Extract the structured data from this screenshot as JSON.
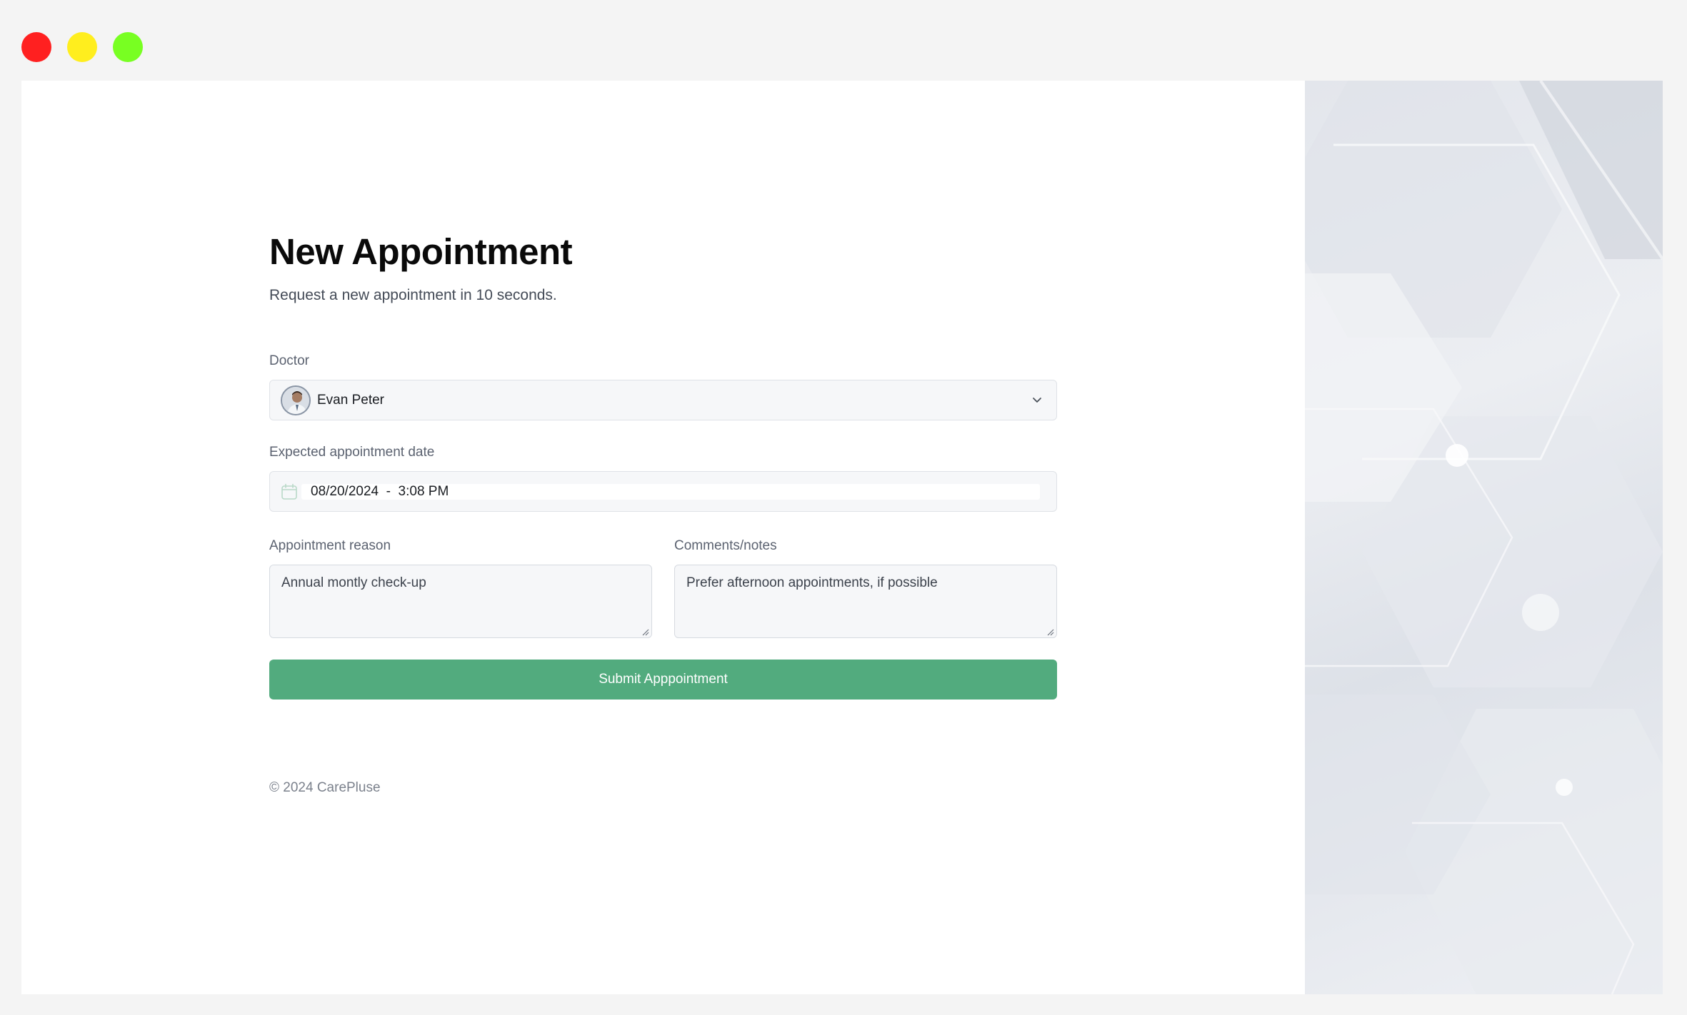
{
  "window_controls": [
    "close",
    "minimize",
    "maximize"
  ],
  "page": {
    "title": "New Appointment",
    "subtitle": "Request a new appointment in 10 seconds."
  },
  "doctor": {
    "label": "Doctor",
    "value": "Evan Peter"
  },
  "date": {
    "label": "Expected appointment date",
    "value": "08/20/2024  -  3:08 PM"
  },
  "reason": {
    "label": "Appointment reason",
    "value": "Annual montly check-up"
  },
  "notes": {
    "label": "Comments/notes",
    "value": "Prefer afternoon appointments, if possible"
  },
  "submit_label": "Submit Apppointment",
  "footer": "© 2024 CarePluse",
  "colors": {
    "accent": "#52ab7e",
    "close": "#ff2020",
    "minimize": "#ffee1e",
    "maximize": "#78ff22"
  }
}
